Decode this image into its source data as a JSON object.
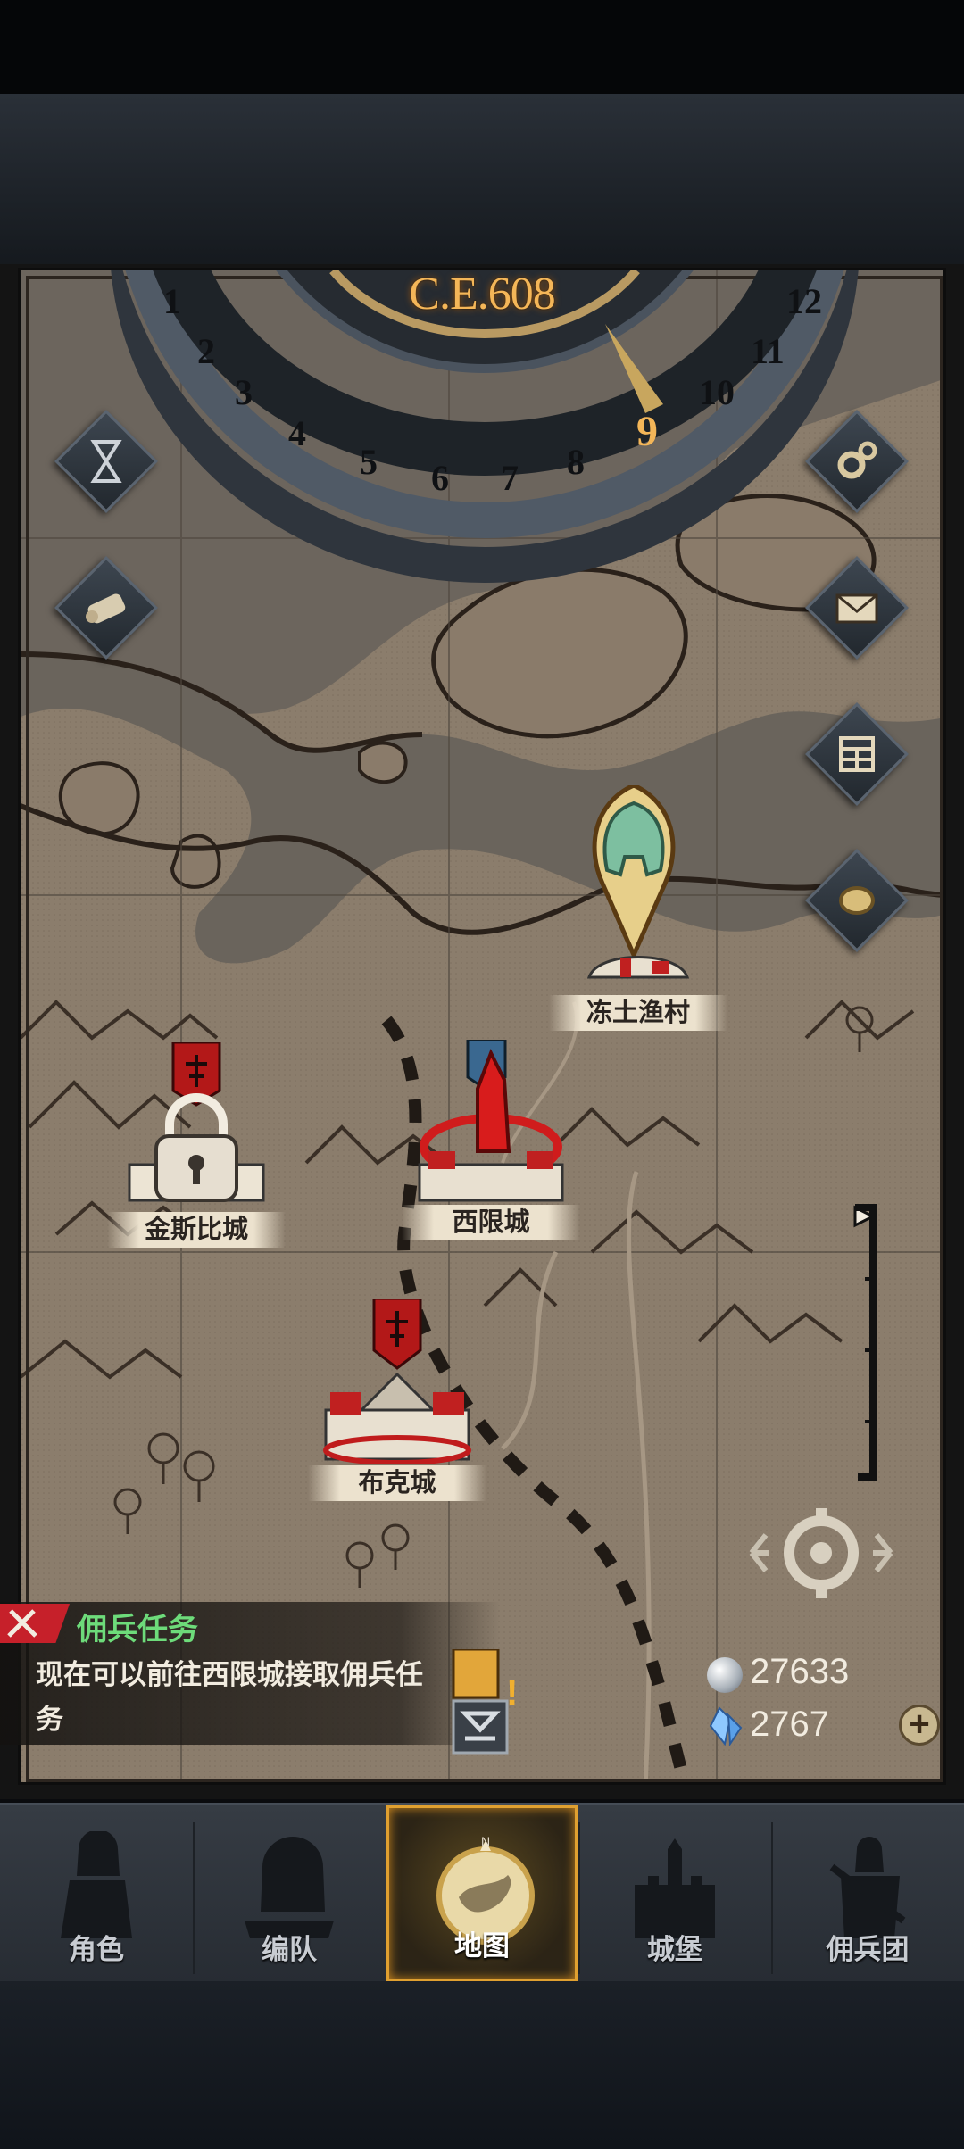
{
  "era": {
    "year": "C.E.608",
    "months": [
      "1",
      "2",
      "3",
      "4",
      "5",
      "6",
      "7",
      "8",
      "9",
      "10",
      "11",
      "12"
    ],
    "current_month": "9"
  },
  "towns": [
    {
      "name": "冻土渔村"
    },
    {
      "name": "金斯比城"
    },
    {
      "name": "西限城"
    },
    {
      "name": "布克城"
    }
  ],
  "side_buttons": [
    {
      "icon": "hourglass-icon"
    },
    {
      "icon": "scroll-icon"
    },
    {
      "icon": "gear-icon"
    },
    {
      "icon": "mail-icon"
    },
    {
      "icon": "grid-icon"
    },
    {
      "icon": "coin-icon"
    }
  ],
  "mission": {
    "title": "佣兵任务",
    "text": "现在可以前往西限城接取佣兵任务"
  },
  "currency": {
    "silver": "27633",
    "crystal": "2767",
    "plus": "+"
  },
  "nav": {
    "items": [
      {
        "label": "角色",
        "icon": "knight-icon"
      },
      {
        "label": "编队",
        "icon": "helmet-icon"
      },
      {
        "label": "地图",
        "icon": "compass-map-icon",
        "active": true
      },
      {
        "label": "城堡",
        "icon": "castle-icon"
      },
      {
        "label": "佣兵团",
        "icon": "mercenary-icon"
      }
    ],
    "compass_letter": "N"
  },
  "colors": {
    "accent": "#e0a030",
    "mission_green": "#6ddb7a",
    "map_parchment": "#8a7b6a",
    "enemy_red": "#d01c1c"
  }
}
